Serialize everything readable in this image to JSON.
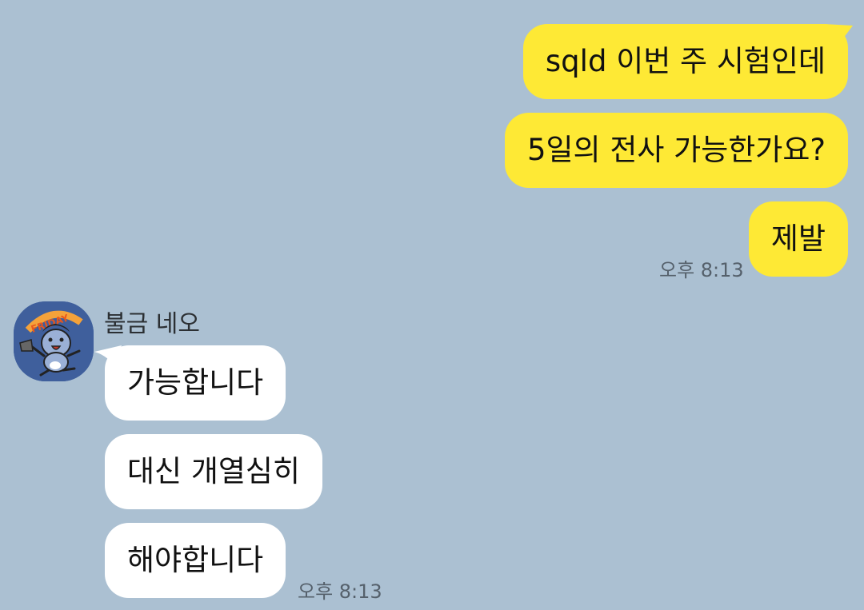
{
  "outgoing": {
    "messages": [
      {
        "text": "sqld 이번 주 시험인데"
      },
      {
        "text": "5일의 전사 가능한가요?"
      },
      {
        "text": "제발"
      }
    ],
    "time": "오후 8:13"
  },
  "incoming": {
    "sender_name": "불금 네오",
    "avatar_text": "FRIDAY",
    "messages": [
      {
        "text": "가능합니다"
      },
      {
        "text": "대신 개열심히"
      },
      {
        "text": "해야합니다"
      }
    ],
    "time": "오후 8:13"
  },
  "colors": {
    "chat_background": "#abc0d2",
    "outgoing_bubble": "#fee935",
    "incoming_bubble": "#ffffff",
    "timestamp": "#55606b",
    "avatar_background": "#3f5f9c"
  }
}
